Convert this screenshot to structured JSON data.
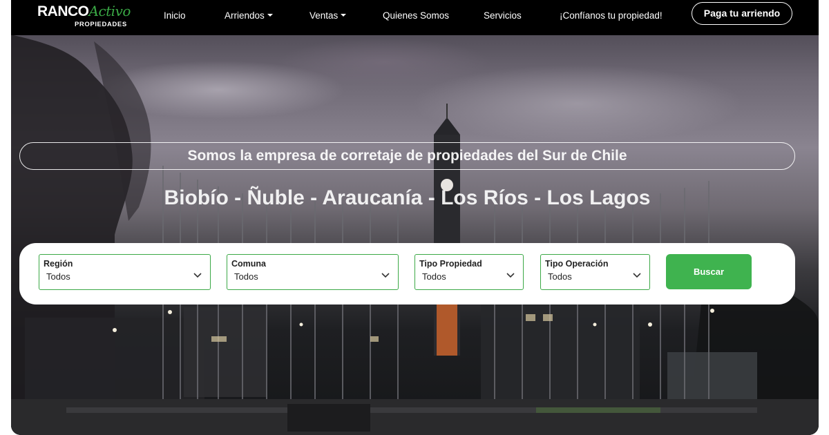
{
  "brand": {
    "name_part1": "RANCO",
    "name_part2": "Activo",
    "subtitle": "PROPIEDADES",
    "accent_color": "#3aa845"
  },
  "nav": {
    "items": [
      {
        "label": "Inicio",
        "has_dropdown": false
      },
      {
        "label": "Arriendos",
        "has_dropdown": true
      },
      {
        "label": "Ventas",
        "has_dropdown": true
      },
      {
        "label": "Quienes Somos",
        "has_dropdown": false
      },
      {
        "label": "Servicios",
        "has_dropdown": false
      },
      {
        "label": "¡Confíanos tu propiedad!",
        "has_dropdown": false
      }
    ],
    "cta_label": "Paga tu arriendo"
  },
  "hero": {
    "tagline": "Somos la empresa de corretaje de propiedades del Sur de Chile",
    "regions": "Biobío - Ñuble - Araucanía - Los Ríos - Los Lagos",
    "background_image": "evening-plaza-clock-tower"
  },
  "search": {
    "fields": [
      {
        "label": "Región",
        "value": "Todos",
        "icon": "chevron-down-icon"
      },
      {
        "label": "Comuna",
        "value": "Todos",
        "icon": "chevron-down-icon"
      },
      {
        "label": "Tipo Propiedad",
        "value": "Todos",
        "icon": "chevron-down-icon"
      },
      {
        "label": "Tipo Operación",
        "value": "Todos",
        "icon": "chevron-down-icon"
      }
    ],
    "button_label": "Buscar",
    "button_color": "#3fb34f"
  }
}
